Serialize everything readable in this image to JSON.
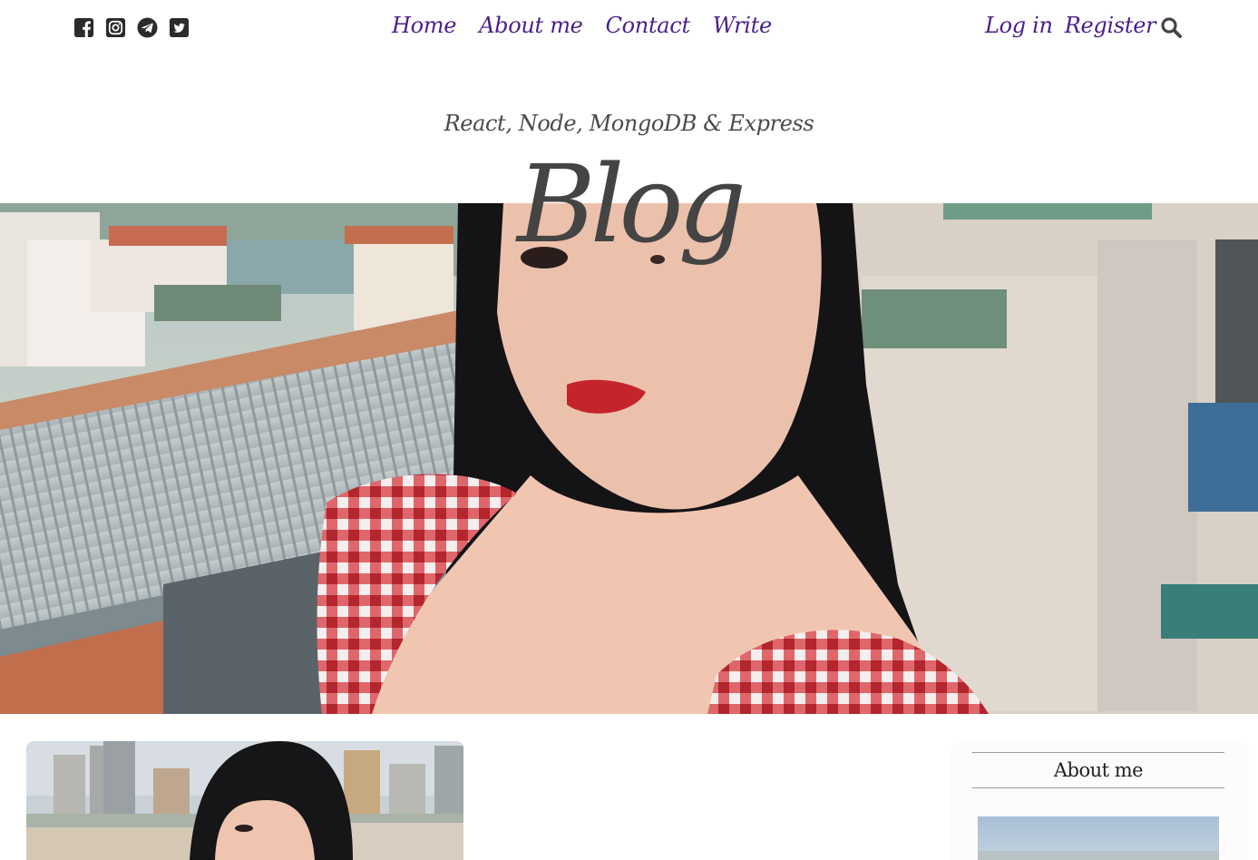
{
  "nav": {
    "social_icons": [
      "facebook-square-icon",
      "instagram-square-icon",
      "telegram-icon",
      "twitter-square-icon"
    ],
    "links": [
      "Home",
      "About me",
      "Contact",
      "Write"
    ],
    "auth": {
      "login": "Log in",
      "register": "Register"
    },
    "search_icon": "search-icon"
  },
  "header": {
    "subtitle": "React, Node, MongoDB & Express",
    "title": "Blog"
  },
  "sidebar": {
    "title": "About me"
  },
  "colors": {
    "nav_link": "#4b1f8a",
    "title_text": "#444444",
    "subtitle_text": "#4a4a4a"
  }
}
